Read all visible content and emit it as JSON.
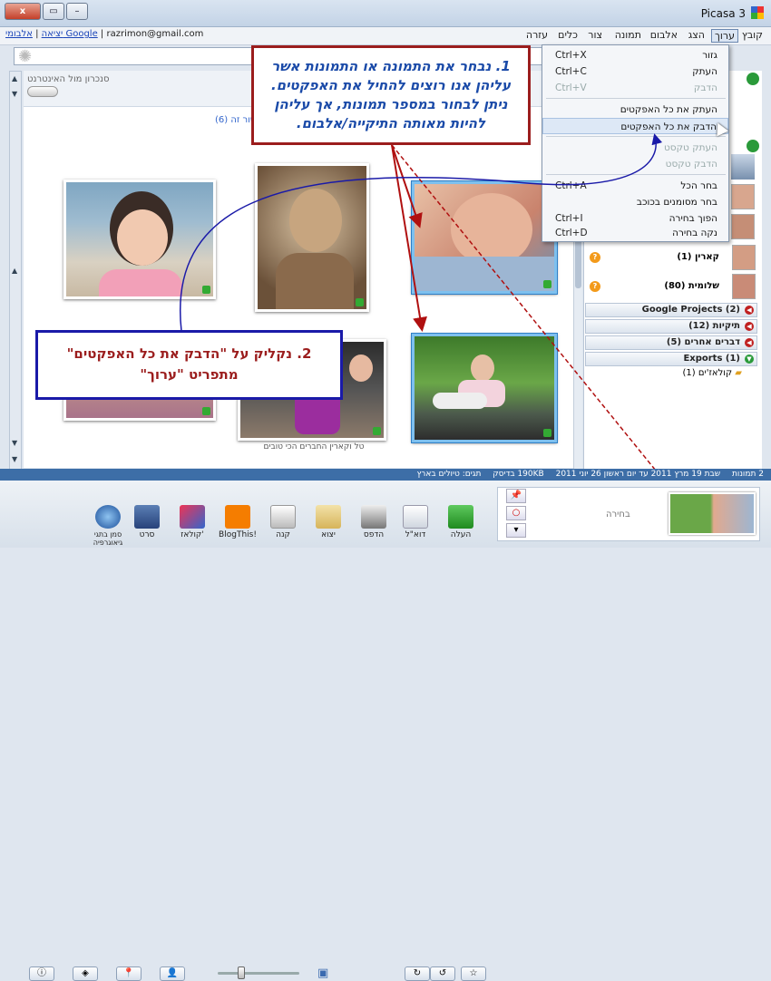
{
  "window": {
    "title": "Picasa 3",
    "close_label": "x",
    "max_label": "▭",
    "min_label": "–"
  },
  "menubar": [
    "קובץ",
    "ערוך",
    "הצג",
    "אלבום",
    "תמונה",
    "צור",
    "כלים",
    "עזרה"
  ],
  "account": {
    "email": "razrimon@gmail.com",
    "web_albums": "אלבומי Google",
    "sep": "|",
    "logout": "יציאה"
  },
  "sync": {
    "label": "סנכרון מול האינטרנט",
    "filter_text": "ישור זה (6)"
  },
  "edit_menu": {
    "items": [
      {
        "label": "גזור",
        "shortcut": "Ctrl+X",
        "disabled": false
      },
      {
        "label": "העתק",
        "shortcut": "Ctrl+C",
        "disabled": false
      },
      {
        "label": "הדבק",
        "shortcut": "Ctrl+V",
        "disabled": true
      },
      {
        "label": "העתק את כל האפקטים",
        "shortcut": "",
        "disabled": false
      },
      {
        "label": "הדבק את כל האפקטים",
        "shortcut": "",
        "disabled": false,
        "highlighted": true
      },
      {
        "label": "העתק טקסט",
        "shortcut": "",
        "disabled": true
      },
      {
        "label": "הדבק טקסט",
        "shortcut": "",
        "disabled": true
      },
      {
        "label": "בחר הכל",
        "shortcut": "Ctrl+A",
        "disabled": false
      },
      {
        "label": "בחר מסומנים בכוכב",
        "shortcut": "",
        "disabled": false
      },
      {
        "label": "הפוך בחירה",
        "shortcut": "Ctrl+I",
        "disabled": false
      },
      {
        "label": "נקה בחירה",
        "shortcut": "Ctrl+D",
        "disabled": false
      }
    ]
  },
  "callout1": {
    "text": "1. נבחר את התמונה או התמונות אשר עליהן אנו רוצים להחיל את האפקטים. ניתן לבחור במספר תמונות, אך עליהן להיות מאותה התיקייה/אלבום."
  },
  "callout2": {
    "text": "2. נקליק על \"הדבק את כל האפקטים\" מתפריט \"ערוך\""
  },
  "people": [
    {
      "name": "קארין (1)"
    },
    {
      "name": "שלומית (80)"
    }
  ],
  "folders": [
    {
      "name": "Google Projects (2)"
    },
    {
      "name": "תיקיות (12)"
    },
    {
      "name": "דברים אחרים (5)"
    },
    {
      "name": "Exports (1)"
    }
  ],
  "subfolder": {
    "name": "קולאז'ים (1)"
  },
  "photo_caption": "טל וקארין החברים הכי טובים",
  "status": {
    "count": "2 תמונות",
    "dates": "שבת 19 מרץ 2011 עד יום ראשון 26 יוני 2011",
    "size": "190KB בדיסק",
    "tags": "תגים: טיולים בארץ"
  },
  "tray": {
    "label": "בחירה"
  },
  "tools": [
    "העלה",
    "דוא\"ל",
    "הדפס",
    "יצוא",
    "קנה",
    "BlogThis!",
    "קולאז'",
    "סרט",
    "סמן בתגי גיאוגרפיה"
  ],
  "colors": {
    "callout1_border": "#9b1d1d",
    "callout1_text": "#1a4aa8",
    "callout2_border": "#1a1aa8",
    "callout2_text": "#9b1d1d",
    "status_bar": "#3d6ea7"
  }
}
